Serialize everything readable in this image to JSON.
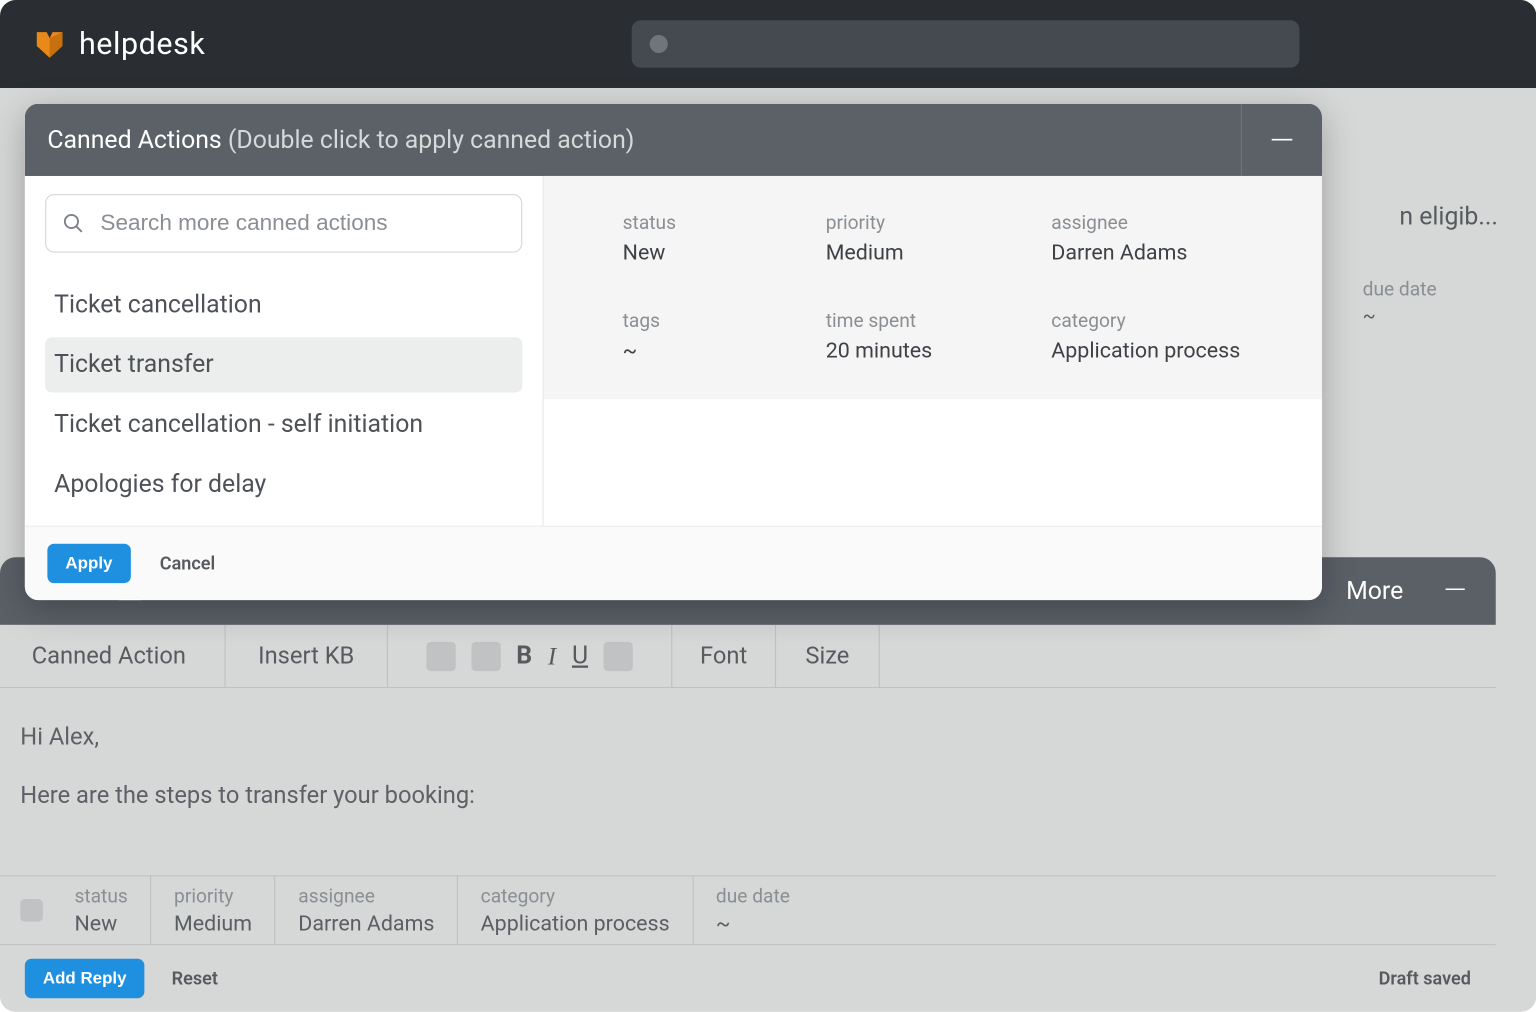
{
  "brand": {
    "name": "helpdesk"
  },
  "search": {
    "placeholder": ""
  },
  "ticket": {
    "title_truncated": "n eligib..."
  },
  "meta_peek": {
    "label": "due date",
    "value": "~"
  },
  "reply_header": {
    "more": "More"
  },
  "toolbar": {
    "canned": "Canned Action",
    "insert_kb": "Insert KB",
    "font": "Font",
    "size": "Size"
  },
  "editor": {
    "line1": "Hi Alex,",
    "line2": "Here are the steps to transfer your booking:"
  },
  "bottom_meta": {
    "status": {
      "lbl": "status",
      "val": "New"
    },
    "priority": {
      "lbl": "priority",
      "val": "Medium"
    },
    "assignee": {
      "lbl": "assignee",
      "val": "Darren Adams"
    },
    "category": {
      "lbl": "category",
      "val": "Application process"
    },
    "due": {
      "lbl": "due date",
      "val": "~"
    }
  },
  "footer": {
    "add_reply": "Add Reply",
    "reset": "Reset",
    "draft_saved": "Draft saved"
  },
  "popup": {
    "title": "Canned Actions",
    "subtitle": "(Double click to apply canned action)",
    "search_placeholder": "Search more canned actions",
    "items": [
      {
        "label": "Ticket cancellation",
        "selected": false
      },
      {
        "label": "Ticket transfer",
        "selected": true
      },
      {
        "label": "Ticket cancellation - self initiation",
        "selected": false
      },
      {
        "label": "Apologies for delay",
        "selected": false
      }
    ],
    "meta": {
      "status": {
        "lbl": "status",
        "val": "New"
      },
      "priority": {
        "lbl": "priority",
        "val": "Medium"
      },
      "assignee": {
        "lbl": "assignee",
        "val": "Darren Adams"
      },
      "tags": {
        "lbl": "tags",
        "val": "~"
      },
      "time": {
        "lbl": "time spent",
        "val": "20 minutes"
      },
      "category": {
        "lbl": "category",
        "val": "Application process"
      }
    },
    "apply": "Apply",
    "cancel": "Cancel"
  }
}
